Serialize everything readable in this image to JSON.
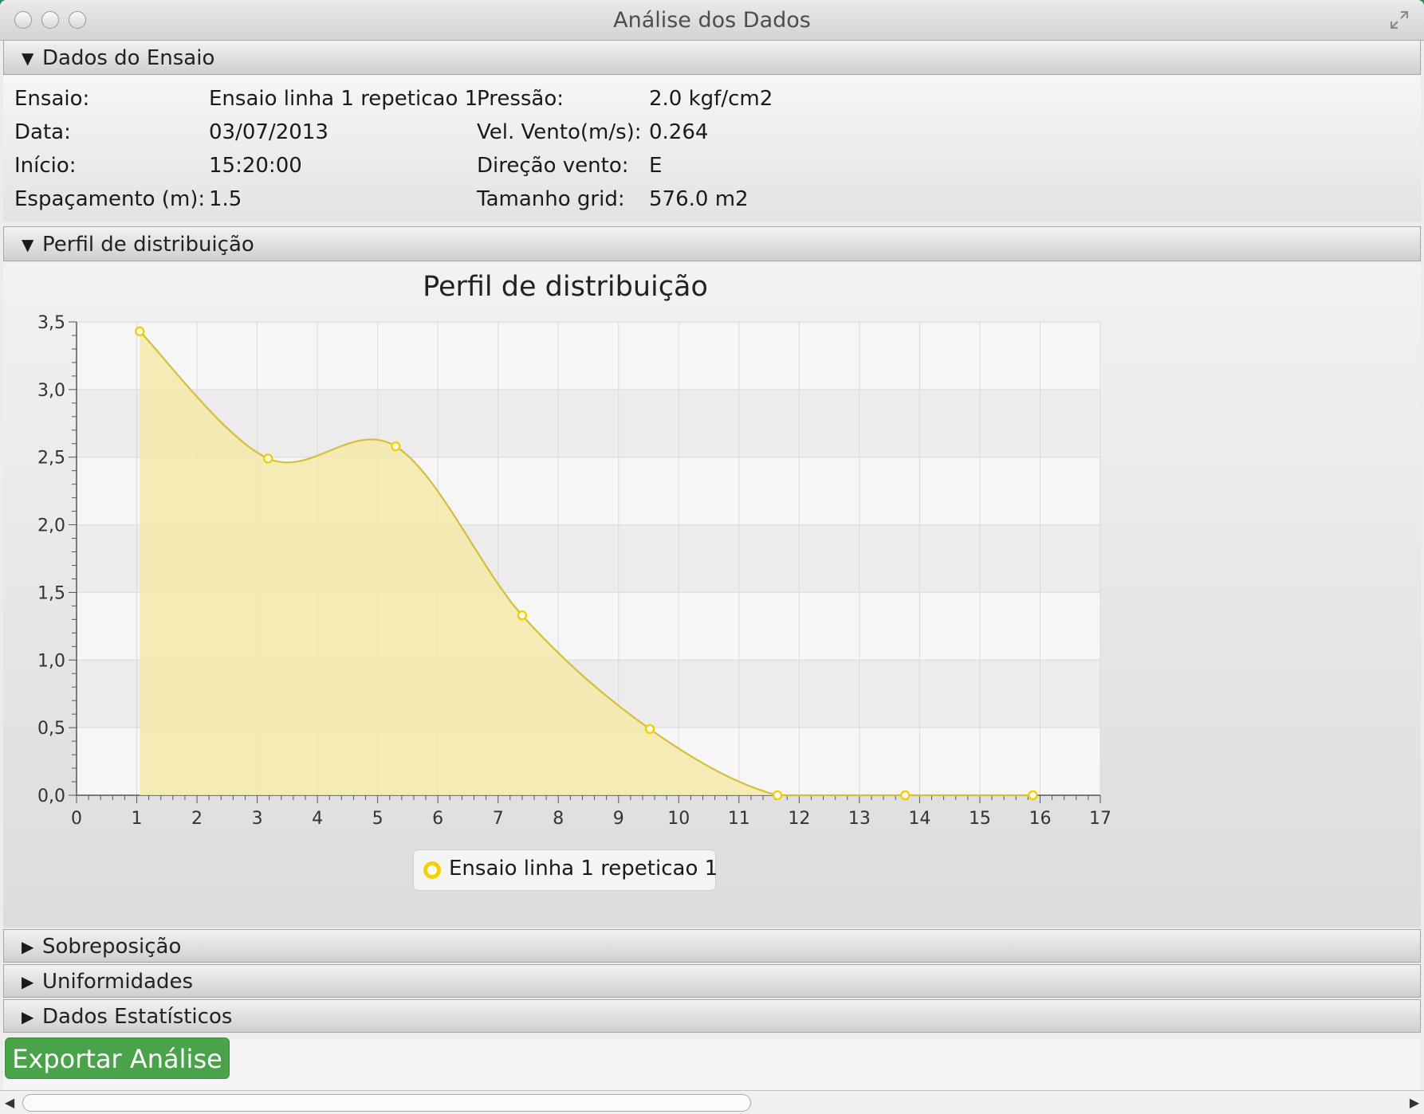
{
  "window": {
    "title": "Análise dos Dados"
  },
  "sections": {
    "dados_ensaio": {
      "label": "Dados do Ensaio"
    },
    "perfil": {
      "label": "Perfil de distribuição"
    },
    "sobreposicao": {
      "label": "Sobreposição"
    },
    "uniformidades": {
      "label": "Uniformidades"
    },
    "estatisticos": {
      "label": "Dados Estatísticos"
    }
  },
  "ensaio": {
    "ensaio_label": "Ensaio:",
    "ensaio_value": "Ensaio linha 1 repeticao 1",
    "data_label": "Data:",
    "data_value": "03/07/2013",
    "inicio_label": "Início:",
    "inicio_value": "15:20:00",
    "espacamento_label": "Espaçamento (m):",
    "espacamento_value": "1.5",
    "pressao_label": "Pressão:",
    "pressao_value": "2.0 kgf/cm2",
    "vento_label": "Vel. Vento(m/s):",
    "vento_value": "0.264",
    "direcao_label": "Direção vento:",
    "direcao_value": "E",
    "grid_label": "Tamanho grid:",
    "grid_value": "576.0 m2"
  },
  "actions": {
    "export_label": "Exportar Análise"
  },
  "chart_data": {
    "type": "area",
    "title": "Perfil de distribuição",
    "xlim": [
      0,
      17
    ],
    "ylim": [
      0,
      3.5
    ],
    "x_ticks": [
      "0",
      "1",
      "2",
      "3",
      "4",
      "5",
      "6",
      "7",
      "8",
      "9",
      "10",
      "11",
      "12",
      "13",
      "14",
      "15",
      "16",
      "17"
    ],
    "y_ticks": [
      "0,0",
      "0,5",
      "1,0",
      "1,5",
      "2,0",
      "2,5",
      "3,0",
      "3,5"
    ],
    "grid": true,
    "legend_position": "bottom",
    "series": [
      {
        "name": "Ensaio linha 1 repeticao 1",
        "color": "#f3d100",
        "fill": "#f5e9a8",
        "x": [
          1.05,
          3.18,
          5.3,
          7.4,
          9.52,
          11.64,
          13.76,
          15.88
        ],
        "y": [
          3.43,
          2.49,
          2.58,
          1.33,
          0.49,
          0.0,
          0.0,
          0.0
        ]
      }
    ]
  }
}
